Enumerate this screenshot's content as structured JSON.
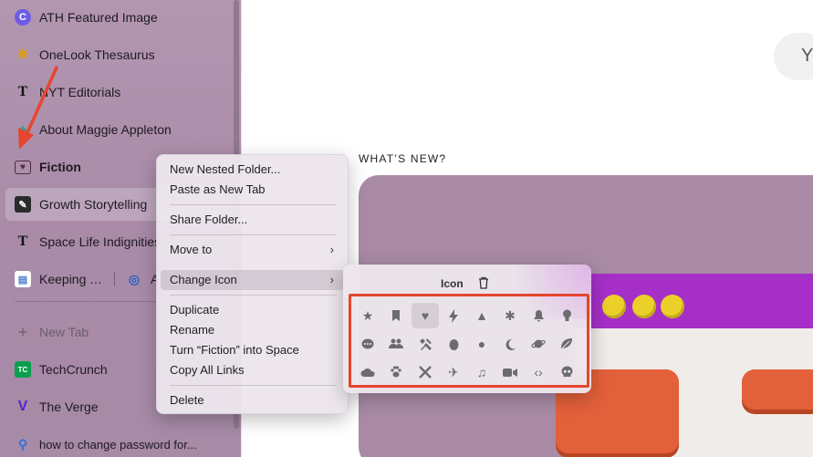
{
  "sidebar": {
    "items": [
      {
        "label": "ATH Featured Image",
        "icon": "canva-icon",
        "icon_glyph": "C",
        "icon_color": "#6e5ce6"
      },
      {
        "label": "OneLook Thesaurus",
        "icon": "sun-icon",
        "icon_glyph": "☀",
        "icon_color": "#e0a000"
      },
      {
        "label": "NYT Editorials",
        "icon": "nyt-icon",
        "icon_glyph": "T",
        "icon_color": "#111111"
      },
      {
        "label": "About Maggie Appleton",
        "icon": "leaf-icon",
        "icon_glyph": "◆",
        "icon_color": "#3a9e8f"
      },
      {
        "label": "Fiction",
        "icon": "folder-heart-icon",
        "icon_glyph": "♥",
        "icon_color": "#6b3a5f"
      },
      {
        "label": "Growth Storytelling",
        "icon": "pen-icon",
        "icon_glyph": "✎",
        "icon_color": "#2b2b2b"
      },
      {
        "label": "Space Life Indignities",
        "icon": "nyt-icon",
        "icon_glyph": "T",
        "icon_color": "#111111"
      },
      {
        "label": "Keeping T...",
        "icon": "doc-icon",
        "icon_glyph": "▤",
        "icon_color": "#4a7bd0"
      },
      {
        "label": "A",
        "icon": "spiral-icon",
        "icon_glyph": "◎",
        "icon_color": "#2f5fc7"
      }
    ],
    "new_tab": "New Tab",
    "pinned": [
      {
        "label": "TechCrunch",
        "icon": "techcrunch-icon",
        "icon_glyph": "TC",
        "icon_color": "#0a9e4f"
      },
      {
        "label": "The Verge",
        "icon": "verge-icon",
        "icon_glyph": "V",
        "icon_color": "#5a1fd1"
      },
      {
        "label": "how to change password for...",
        "icon": "search-icon",
        "icon_glyph": "⚲",
        "icon_color": "#2f6fe0"
      }
    ]
  },
  "main": {
    "pill_text": "Y",
    "whats_new": "WHAT’S NEW?"
  },
  "context_menu": {
    "items": [
      {
        "label": "New Nested Folder..."
      },
      {
        "label": "Paste as New Tab"
      },
      {
        "label": "Share Folder..."
      },
      {
        "label": "Move to",
        "arrow": "›"
      },
      {
        "label": "Change Icon",
        "arrow": "›"
      },
      {
        "label": "Duplicate"
      },
      {
        "label": "Rename"
      },
      {
        "label": "Turn “Fiction” into Space"
      },
      {
        "label": "Copy All Links"
      },
      {
        "label": "Delete"
      }
    ]
  },
  "icon_menu": {
    "title": "Icon",
    "trash_icon": "trash-icon",
    "icons": [
      [
        "star-icon",
        "bookmark-icon",
        "heart-icon",
        "bolt-icon",
        "triangle-icon",
        "asterisk-icon",
        "bell-icon",
        "lightbulb-icon"
      ],
      [
        "chat-icon",
        "people-icon",
        "tools-icon",
        "egg-icon",
        "circle-icon",
        "moon-icon",
        "planet-icon",
        "leaf-icon"
      ],
      [
        "cloud-icon",
        "paw-icon",
        "crossed-tools-icon",
        "airplane-icon",
        "music-icon",
        "video-icon",
        "code-icon",
        "skull-icon"
      ]
    ],
    "selected": "heart-icon"
  },
  "colors": {
    "sidebar": "#aa8ca9",
    "highlight_box": "#e5452f",
    "arrow": "#e8452f",
    "accent_purple": "#a52fc7"
  }
}
